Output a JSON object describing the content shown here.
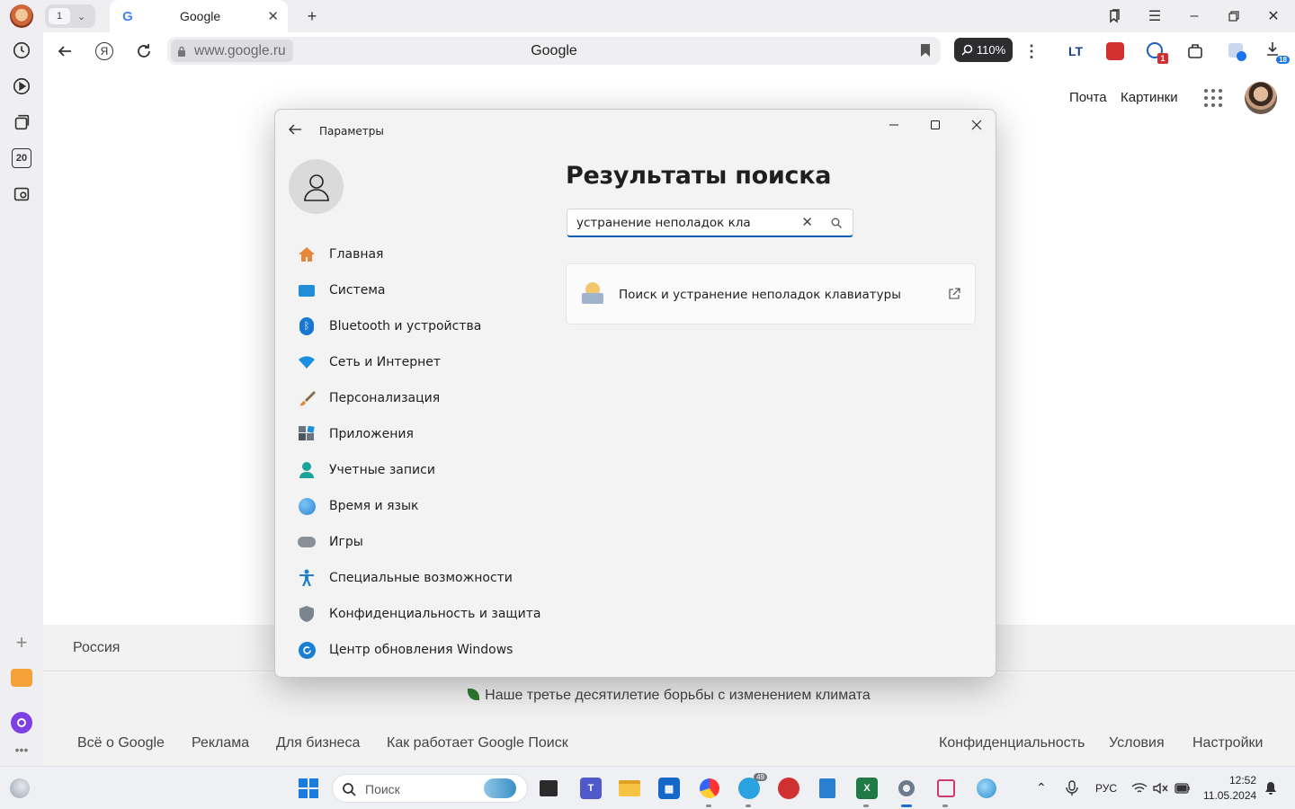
{
  "browser": {
    "tab_count": "1",
    "tab": {
      "title": "Google",
      "favicon": "G"
    },
    "address": {
      "host": "www.google.ru",
      "page_title": "Google"
    },
    "zoom": "110%",
    "extensions": [
      {
        "name": "lt-icon",
        "label": "LT"
      },
      {
        "name": "dislike-icon",
        "label": ""
      },
      {
        "name": "ext-badge-icon",
        "label": "1"
      },
      {
        "name": "box-icon",
        "label": ""
      },
      {
        "name": "translate-icon",
        "label": ""
      },
      {
        "name": "download-icon",
        "label": "18"
      }
    ],
    "sidebar_badge": "20"
  },
  "google": {
    "header_links": [
      "Почта",
      "Картинки"
    ],
    "country": "Россия",
    "climate": "Наше третье десятилетие борьбы с изменением климата",
    "footer_left": [
      "Всё о Google",
      "Реклама",
      "Для бизнеса",
      "Как работает Google Поиск"
    ],
    "footer_right": [
      "Конфиденциальность",
      "Условия",
      "Настройки"
    ]
  },
  "settings": {
    "window_title": "Параметры",
    "heading": "Результаты поиска",
    "search_query": "устранение неполадок кла",
    "nav": [
      {
        "label": "Главная",
        "icon": "home-icon",
        "color": "#e8873a"
      },
      {
        "label": "Система",
        "icon": "system-icon",
        "color": "#1e8fd6"
      },
      {
        "label": "Bluetooth и устройства",
        "icon": "bluetooth-icon",
        "color": "#1877d2"
      },
      {
        "label": "Сеть и Интернет",
        "icon": "network-icon",
        "color": "#1b8fe0"
      },
      {
        "label": "Персонализация",
        "icon": "brush-icon",
        "color": "#e08a3a"
      },
      {
        "label": "Приложения",
        "icon": "apps-icon",
        "color": "#4a5560"
      },
      {
        "label": "Учетные записи",
        "icon": "accounts-icon",
        "color": "#1aa39a"
      },
      {
        "label": "Время и язык",
        "icon": "time-language-icon",
        "color": "#2a86d6"
      },
      {
        "label": "Игры",
        "icon": "gamepad-icon",
        "color": "#8a9098"
      },
      {
        "label": "Специальные возможности",
        "icon": "accessibility-icon",
        "color": "#1e7fd0"
      },
      {
        "label": "Конфиденциальность и защита",
        "icon": "shield-icon",
        "color": "#7b8590"
      },
      {
        "label": "Центр обновления Windows",
        "icon": "update-icon",
        "color": "#1a7fd4"
      }
    ],
    "result": {
      "label": "Поиск и устранение неполадок клавиатуры"
    }
  },
  "taskbar": {
    "search_placeholder": "Поиск",
    "telegram_badge": "49",
    "language": "РУС",
    "time": "12:52",
    "date": "11.05.2024"
  }
}
